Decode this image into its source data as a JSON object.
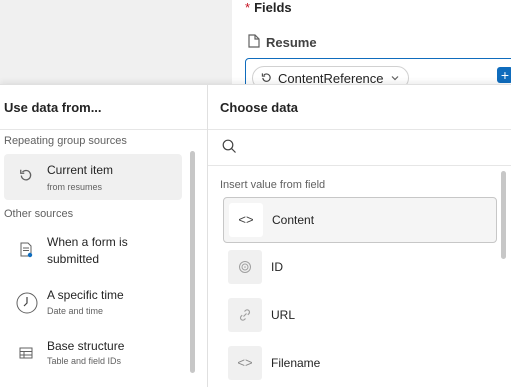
{
  "form": {
    "fields_label": "Fields",
    "required_marker": "*",
    "resume_label": "Resume",
    "token_label": "ContentReference"
  },
  "left_panel": {
    "title": "Use data from...",
    "repeating_section": "Repeating group sources",
    "other_section": "Other sources",
    "items": [
      {
        "title": "Current item",
        "subtitle": "from resumes",
        "icon": "reset-icon"
      },
      {
        "title": "When a form is submitted",
        "subtitle": "",
        "icon": "form-icon"
      },
      {
        "title": "A specific time",
        "subtitle": "Date and time",
        "icon": "clock-icon"
      },
      {
        "title": "Base structure",
        "subtitle": "Table and field IDs",
        "icon": "table-icon"
      }
    ]
  },
  "right_panel": {
    "title": "Choose data",
    "search_placeholder": "",
    "section": "Insert value from field",
    "fields": [
      {
        "label": "Content",
        "icon": "code-icon"
      },
      {
        "label": "ID",
        "icon": "fingerprint-icon"
      },
      {
        "label": "URL",
        "icon": "link-icon"
      },
      {
        "label": "Filename",
        "icon": "code-icon"
      }
    ]
  },
  "colors": {
    "accent": "#0f6cbd",
    "required": "#c50f1f"
  }
}
